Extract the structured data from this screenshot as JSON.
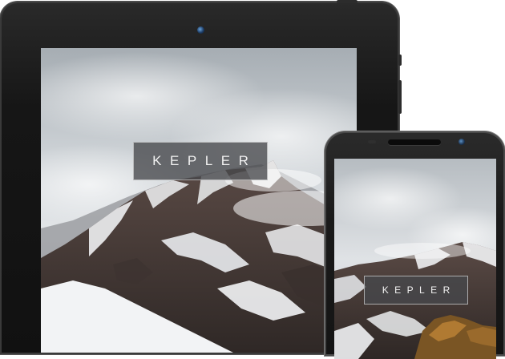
{
  "devices": {
    "tablet": {
      "app_title": "KEPLER"
    },
    "phone": {
      "app_title": "KEPLER"
    }
  },
  "colors": {
    "device_frame": "#161616",
    "title_box_bg": "#46484c",
    "sky": "#dfe3e6",
    "rock": "#4a3d38",
    "snow": "#f4f5f6"
  },
  "icons": [
    "camera-icon",
    "speaker-grille",
    "side-button"
  ]
}
